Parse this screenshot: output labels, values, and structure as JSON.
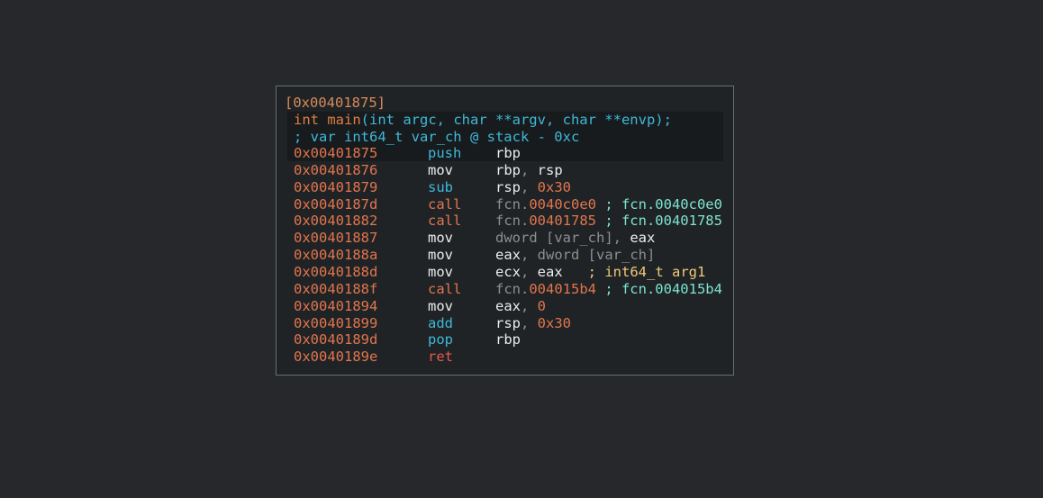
{
  "block": {
    "title": "[0x00401875]",
    "signature": {
      "ret_type": "int",
      "name": "main",
      "args": "(int argc, char **argv, char **envp);"
    },
    "var_comment": "; var int64_t var_ch @ stack - 0xc"
  },
  "instructions": [
    {
      "addr": "0x00401875",
      "mnemonic": "push",
      "mn_color": "cyan",
      "operands": [
        {
          "t": "rbp",
          "c": "white"
        }
      ]
    },
    {
      "addr": "0x00401876",
      "mnemonic": "mov",
      "mn_color": "white",
      "operands": [
        {
          "t": "rbp",
          "c": "white"
        },
        {
          "t": ", ",
          "c": "gray"
        },
        {
          "t": "rsp",
          "c": "white"
        }
      ]
    },
    {
      "addr": "0x00401879",
      "mnemonic": "sub",
      "mn_color": "cyan",
      "operands": [
        {
          "t": "rsp",
          "c": "white"
        },
        {
          "t": ", ",
          "c": "gray"
        },
        {
          "t": "0x30",
          "c": "orange"
        }
      ]
    },
    {
      "addr": "0x0040187d",
      "mnemonic": "call",
      "mn_color": "orange",
      "operands": [
        {
          "t": "fcn.",
          "c": "gray"
        },
        {
          "t": "0040c0e0",
          "c": "orange"
        },
        {
          "t": " ; fcn.0040c0e0",
          "c": "aqua"
        }
      ]
    },
    {
      "addr": "0x00401882",
      "mnemonic": "call",
      "mn_color": "orange",
      "operands": [
        {
          "t": "fcn.",
          "c": "gray"
        },
        {
          "t": "00401785",
          "c": "orange"
        },
        {
          "t": " ; fcn.00401785",
          "c": "aqua"
        }
      ]
    },
    {
      "addr": "0x00401887",
      "mnemonic": "mov",
      "mn_color": "white",
      "operands": [
        {
          "t": "dword [var_ch]",
          "c": "gray"
        },
        {
          "t": ", ",
          "c": "gray"
        },
        {
          "t": "eax",
          "c": "white"
        }
      ]
    },
    {
      "addr": "0x0040188a",
      "mnemonic": "mov",
      "mn_color": "white",
      "operands": [
        {
          "t": "eax",
          "c": "white"
        },
        {
          "t": ", dword [var_ch]",
          "c": "gray"
        }
      ]
    },
    {
      "addr": "0x0040188d",
      "mnemonic": "mov",
      "mn_color": "white",
      "operands": [
        {
          "t": "ecx",
          "c": "white"
        },
        {
          "t": ", ",
          "c": "gray"
        },
        {
          "t": "eax",
          "c": "white"
        },
        {
          "t": "   ; int64_t arg1",
          "c": "yellow"
        }
      ]
    },
    {
      "addr": "0x0040188f",
      "mnemonic": "call",
      "mn_color": "orange",
      "operands": [
        {
          "t": "fcn.",
          "c": "gray"
        },
        {
          "t": "004015b4",
          "c": "orange"
        },
        {
          "t": " ; fcn.004015b4",
          "c": "aqua"
        }
      ]
    },
    {
      "addr": "0x00401894",
      "mnemonic": "mov",
      "mn_color": "white",
      "operands": [
        {
          "t": "eax",
          "c": "white"
        },
        {
          "t": ", ",
          "c": "gray"
        },
        {
          "t": "0",
          "c": "orange"
        }
      ]
    },
    {
      "addr": "0x00401899",
      "mnemonic": "add",
      "mn_color": "cyan",
      "operands": [
        {
          "t": "rsp",
          "c": "white"
        },
        {
          "t": ", ",
          "c": "gray"
        },
        {
          "t": "0x30",
          "c": "orange"
        }
      ]
    },
    {
      "addr": "0x0040189d",
      "mnemonic": "pop",
      "mn_color": "cyan",
      "operands": [
        {
          "t": "rbp",
          "c": "white"
        }
      ]
    },
    {
      "addr": "0x0040189e",
      "mnemonic": "ret",
      "mn_color": "red",
      "operands": []
    }
  ]
}
